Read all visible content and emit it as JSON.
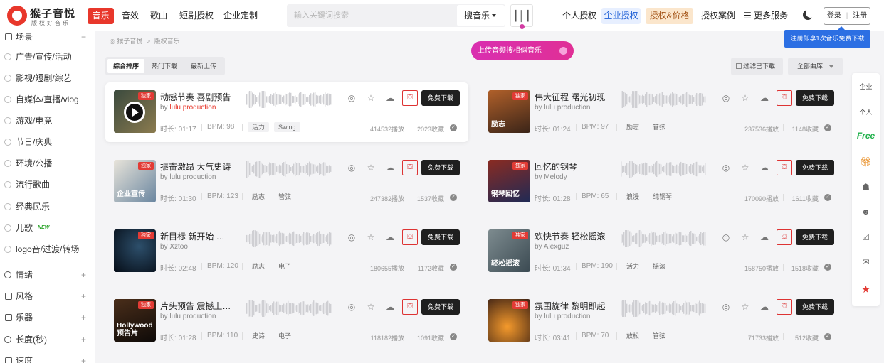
{
  "header": {
    "logo_title": "猴子音悦",
    "logo_sub": "版权好音乐",
    "nav": [
      "音乐",
      "音效",
      "歌曲",
      "短剧授权",
      "企业定制"
    ],
    "search_placeholder": "输入关键词搜索",
    "search_select": "搜音乐",
    "right_nav": [
      "个人授权",
      "企业授权",
      "授权&价格",
      "授权案例",
      "更多服务"
    ],
    "login": "登录",
    "register": "注册",
    "tooltip": "注册即享1次音乐免费下载",
    "upload_btn": "上传音频搜相似音乐"
  },
  "sidebar": {
    "section_top": "场景",
    "items": [
      "广告/宣传/活动",
      "影视/短剧/综艺",
      "自媒体/直播/vlog",
      "游戏/电竞",
      "节日/庆典",
      "环境/公播",
      "流行歌曲",
      "经典民乐",
      "儿歌",
      "logo音/过渡/转场"
    ],
    "new_badge": "NEW",
    "groups": [
      "情绪",
      "风格",
      "乐器",
      "长度(秒)",
      "速度"
    ]
  },
  "breadcrumb": [
    "猴子音悦",
    "版权音乐"
  ],
  "sort_tabs": [
    "综合排序",
    "热门下载",
    "最新上传"
  ],
  "filter_downloaded": "过滤已下载",
  "library_select": "全部曲库",
  "labels": {
    "exclusive": "独家",
    "download": "免费下载",
    "by": "by",
    "duration_prefix": "时长: ",
    "bpm_prefix": "BPM: ",
    "plays_suffix": "播放",
    "favs_suffix": "收藏"
  },
  "tracks": [
    {
      "title": "动感节奏 喜剧预告",
      "author": "lulu production",
      "duration": "01:17",
      "bpm": "98",
      "tags": [
        "活力",
        "Swing"
      ],
      "plays": "414532",
      "favs": "2023",
      "thumb_text": ""
    },
    {
      "title": "伟大征程 曙光初现",
      "author": "lulu production",
      "duration": "01:24",
      "bpm": "97",
      "tags": [
        "励志",
        "管弦"
      ],
      "plays": "237536",
      "favs": "1148",
      "thumb_text": "励志"
    },
    {
      "title": "振奋激昂 大气史诗",
      "author": "lulu production",
      "duration": "01:30",
      "bpm": "123",
      "tags": [
        "励志",
        "管弦"
      ],
      "plays": "247382",
      "favs": "1537",
      "thumb_text": "企业宣传"
    },
    {
      "title": "回忆的钢琴",
      "author": "Melody",
      "duration": "01:28",
      "bpm": "65",
      "tags": [
        "浪漫",
        "纯钢琴"
      ],
      "plays": "170090",
      "favs": "1611",
      "thumb_text": "钢琴回忆"
    },
    {
      "title": "新目标 新开始 科技 ...",
      "author": "Xztoo",
      "duration": "02:48",
      "bpm": "120",
      "tags": [
        "励志",
        "电子"
      ],
      "plays": "180655",
      "favs": "1172",
      "thumb_text": ""
    },
    {
      "title": "欢快节奏 轻松摇滚",
      "author": "Alexguz",
      "duration": "01:34",
      "bpm": "190",
      "tags": [
        "活力",
        "摇滚"
      ],
      "plays": "158750",
      "favs": "1518",
      "thumb_text": "轻松摇滚"
    },
    {
      "title": "片头预告 震撼上映H...",
      "author": "lulu production",
      "duration": "01:28",
      "bpm": "110",
      "tags": [
        "史诗",
        "电子"
      ],
      "plays": "118182",
      "favs": "1091",
      "thumb_text": "Hollywood 预告片"
    },
    {
      "title": "氛围旋律 黎明即起",
      "author": "lulu production",
      "duration": "03:41",
      "bpm": "70",
      "tags": [
        "放松",
        "管弦"
      ],
      "plays": "71733",
      "favs": "512",
      "thumb_text": ""
    }
  ],
  "right_panel": [
    "企业",
    "个人",
    "Free"
  ],
  "colors": {
    "brand": "#e8372b",
    "accent_blue": "#2c6fe3",
    "upload_pink": "#d92fb0"
  }
}
